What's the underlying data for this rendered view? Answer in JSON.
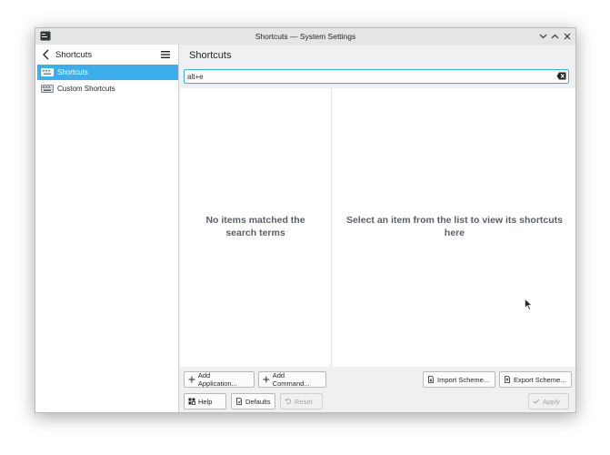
{
  "window": {
    "title": "Shortcuts — System Settings"
  },
  "sidebar": {
    "header_title": "Shortcuts",
    "items": [
      {
        "label": "Shortcuts",
        "active": true
      },
      {
        "label": "Custom Shortcuts",
        "active": false
      }
    ]
  },
  "main": {
    "page_title": "Shortcuts",
    "search": {
      "value": "alt+e",
      "placeholder": ""
    },
    "left_pane_message": "No items matched the search terms",
    "right_pane_message": "Select an item from the list to view its shortcuts here"
  },
  "buttons": {
    "add_application": "Add Application...",
    "add_command": "Add Command...",
    "import_scheme": "Import Scheme...",
    "export_scheme": "Export Scheme...",
    "help": "Help",
    "defaults": "Defaults",
    "reset": "Reset",
    "apply": "Apply"
  },
  "colors": {
    "accent": "#3daee9",
    "window_bg": "#eff0f1",
    "text": "#232629"
  }
}
